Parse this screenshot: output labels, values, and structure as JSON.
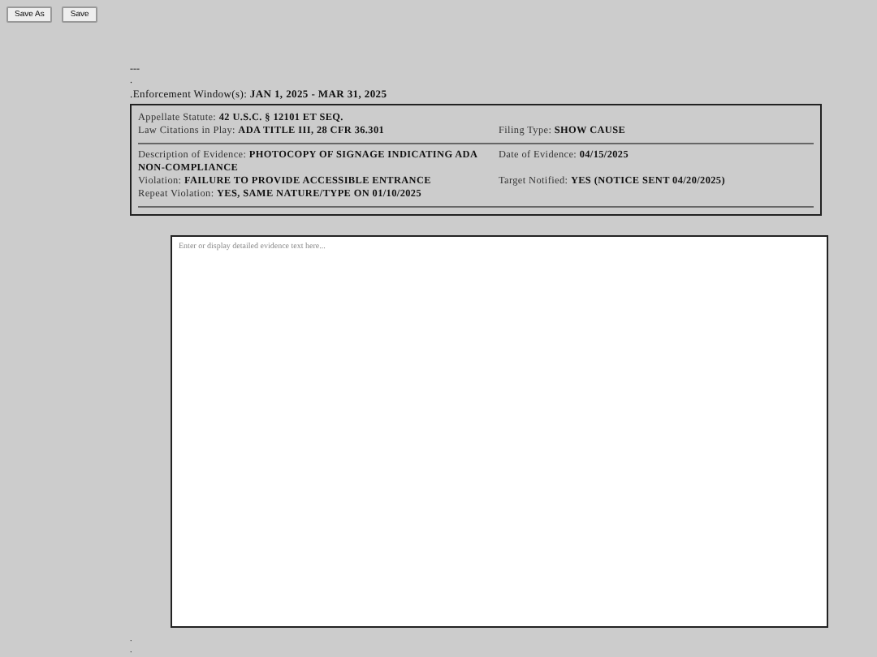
{
  "toolbar": {
    "buttons": [
      "Save As",
      "Save"
    ]
  },
  "markers_top": [
    "---",
    "."
  ],
  "enforcement_window": {
    "prefix": ".",
    "label": "Enforcement Window(s):",
    "value": "JAN 1, 2025 - MAR 31, 2025"
  },
  "summary": {
    "sections": [
      {
        "rows": [
          [
            {
              "label": "Appellate Statute:",
              "value": "42 U.S.C. § 12101 ET SEQ."
            }
          ],
          [
            {
              "label": "Law Citations in Play:",
              "value": "ADA TITLE III, 28 CFR 36.301"
            },
            {
              "label": "Filing Type:",
              "value": "SHOW CAUSE"
            }
          ]
        ]
      },
      {
        "rows": [
          [
            {
              "label": "Description of Evidence:",
              "value": "PHOTOCOPY OF SIGNAGE INDICATING ADA NON-COMPLIANCE"
            },
            {
              "label": "Date of Evidence:",
              "value": "04/15/2025"
            }
          ],
          [
            {
              "label": "Violation:",
              "value": "FAILURE TO PROVIDE ACCESSIBLE ENTRANCE"
            },
            {
              "label": "Target Notified:",
              "value": "YES (NOTICE SENT 04/20/2025)"
            }
          ],
          [
            {
              "label": "Repeat Violation:",
              "value": "YES, SAME NATURE/TYPE ON 01/10/2025"
            }
          ]
        ]
      }
    ]
  },
  "evidence_text": {
    "placeholder": "Enter or display detailed evidence text here..."
  },
  "markers_bottom": [
    ".",
    "."
  ]
}
